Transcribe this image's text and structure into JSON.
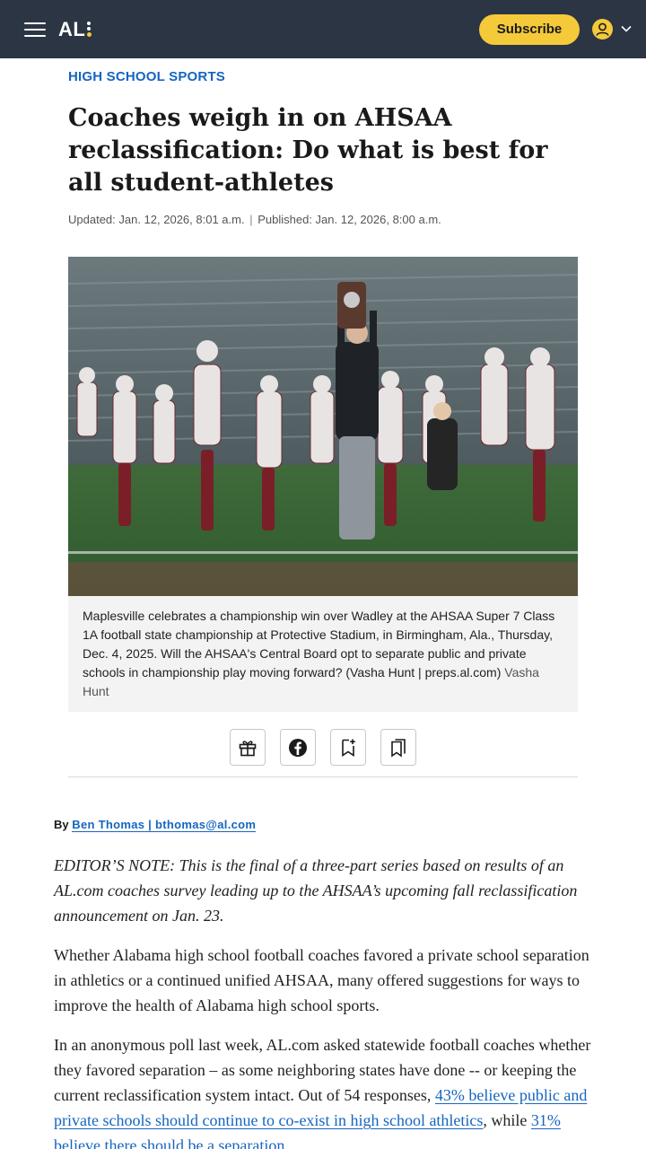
{
  "header": {
    "logo_text": "AL",
    "subscribe_label": "Subscribe",
    "accent_color": "#f4c93a",
    "bar_color": "#2b3544",
    "icons": {
      "menu": "hamburger-icon",
      "account": "user-icon",
      "expand": "chevron-down-icon"
    }
  },
  "article": {
    "section": "HIGH SCHOOL SPORTS",
    "headline": "Coaches weigh in on AHSAA reclassification: Do what is best for all student-athletes",
    "updated": "Updated: Jan. 12, 2026, 8:01 a.m.",
    "published": "Published: Jan. 12, 2026, 8:00 a.m.",
    "date_separator": "|",
    "caption": "Maplesville celebrates a championship win over Wadley at the AHSAA Super 7 Class 1A football state championship at Protective Stadium, in Birmingham, Ala., Thursday, Dec. 4, 2025. Will the AHSAA's Central Board opt to separate public and private schools in championship play moving forward? (Vasha Hunt | preps.al.com)",
    "caption_credit": "Vasha Hunt",
    "share_icons": [
      "gift-icon",
      "facebook-icon",
      "bookmark-add-icon",
      "bookmarks-icon"
    ],
    "byline_prefix": "By",
    "byline_author": "Ben Thomas | bthomas@al.com",
    "paragraphs": {
      "editors_note": "EDITOR’S NOTE: This is the final of a three-part series based on results of an AL.com coaches survey leading up to the AHSAA’s upcoming fall reclassification announcement on Jan. 23.",
      "p2": "Whether Alabama high school football coaches favored a private school separation in athletics or a continued unified AHSAA, many offered suggestions for ways to improve the health of Alabama high school sports.",
      "p3_start": "In an anonymous poll last week, AL.com asked statewide football coaches whether they favored separation – as some neighboring states have done -- or keeping the current reclassification system intact. Out of 54 responses, ",
      "p3_link1": "43% believe public and private schools should continue to co-exist in high school athletics",
      "p3_mid": ", while ",
      "p3_link2": "31% believe there should be a separation",
      "p3_end": "."
    },
    "link_color": "#1565c0"
  }
}
